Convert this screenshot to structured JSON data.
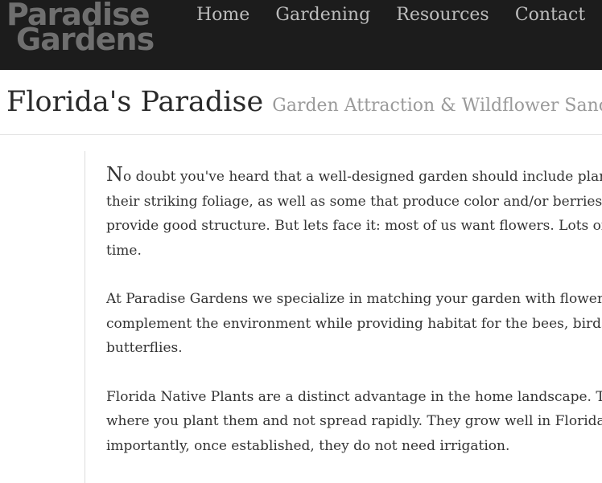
{
  "logo": {
    "line1": "Paradise",
    "line2": "Gardens"
  },
  "nav": {
    "items": [
      {
        "label": "Home"
      },
      {
        "label": "Gardening"
      },
      {
        "label": "Resources"
      },
      {
        "label": "Contact"
      }
    ]
  },
  "header": {
    "title": "Florida's Paradise",
    "subtitle": "Garden Attraction & Wildflower Sanctu"
  },
  "content": {
    "p1": {
      "dropcap": "N",
      "lines": [
        "o doubt you've heard that a well-designed garden should include plants",
        "their striking foliage, as well as some that produce color and/or berries, ar",
        "provide good structure. But lets face it: most of us want flowers. Lots of the",
        "time."
      ]
    },
    "p2": {
      "lines": [
        "At Paradise Gardens we specialize in matching your garden with flowers t",
        "complement the environment while providing habitat for the bees, birds a",
        "butterflies."
      ]
    },
    "p3": {
      "lines": [
        "Florida Native Plants are a distinct advantage in the home landscape. They",
        "where you plant them and not spread rapidly. They grow well in Florida a",
        "importantly, once established, they do not need irrigation."
      ]
    }
  },
  "colors": {
    "topbar_bg": "#1c1c1c",
    "logo_text": "#6f6f6f",
    "nav_text": "#bdbdbd",
    "title_text": "#2a2a2a",
    "subtitle_text": "#9a9a9a",
    "body_text": "#333333"
  }
}
